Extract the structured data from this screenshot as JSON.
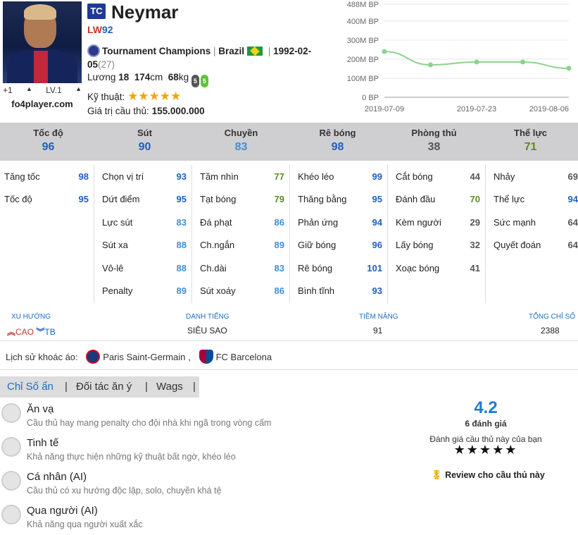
{
  "player": {
    "season_badge": "TC",
    "name": "Neymar",
    "position": "LW",
    "ovr": "92",
    "season": "Tournament Champions",
    "nation": "Brazil",
    "birth": "1992-02-",
    "birth2": "05",
    "age": "(27)",
    "salary_label": "Lương",
    "salary": "18",
    "height": "174",
    "height_unit": "cm",
    "weight": "68",
    "weight_unit": "kg",
    "left_foot": "5",
    "right_foot": "5",
    "skill_label": "Kỹ thuật:",
    "skill_stars": "★★★★★",
    "value_label": "Giá trị cầu thủ:",
    "value": "155.000.000",
    "upgrade": "+1",
    "level": "LV.1",
    "site": "fo4player.com"
  },
  "chart_data": {
    "type": "line",
    "x": [
      "2019-07-09",
      "2019-07-16",
      "2019-07-23",
      "2019-07-30",
      "2019-08-06"
    ],
    "values": [
      240,
      170,
      185,
      185,
      152
    ],
    "y_ticks": [
      "488M BP",
      "400M BP",
      "300M BP",
      "200M BP",
      "100M BP",
      "0 BP"
    ],
    "y_tick_values": [
      488,
      400,
      300,
      200,
      100,
      0
    ],
    "x_ticks": [
      "2019-07-09",
      "2019-07-23",
      "2019-08-06"
    ],
    "ylim": [
      0,
      488
    ],
    "line_color": "#8cd28e",
    "grid": true
  },
  "main_stats": [
    {
      "label": "Tốc độ",
      "value": "96",
      "color": "#1f5fc4"
    },
    {
      "label": "Sút",
      "value": "90",
      "color": "#1f5fc4"
    },
    {
      "label": "Chuyền",
      "value": "83",
      "color": "#3d8fd6"
    },
    {
      "label": "Rê bóng",
      "value": "98",
      "color": "#1f5fc4"
    },
    {
      "label": "Phòng thủ",
      "value": "38",
      "color": "#555555"
    },
    {
      "label": "Thể lực",
      "value": "71",
      "color": "#5a8a2e"
    }
  ],
  "attributes": [
    [
      {
        "label": "Tăng tốc",
        "value": "98",
        "color": "#1f5fc4"
      },
      {
        "label": "Tốc độ",
        "value": "95",
        "color": "#1f5fc4"
      }
    ],
    [
      {
        "label": "Chọn vị trí",
        "value": "93",
        "color": "#1f5fc4"
      },
      {
        "label": "Dứt điểm",
        "value": "95",
        "color": "#1f5fc4"
      },
      {
        "label": "Lực sút",
        "value": "83",
        "color": "#3d8fd6"
      },
      {
        "label": "Sút xa",
        "value": "88",
        "color": "#3d8fd6"
      },
      {
        "label": "Vô-lê",
        "value": "88",
        "color": "#3d8fd6"
      },
      {
        "label": "Penalty",
        "value": "89",
        "color": "#3d8fd6"
      }
    ],
    [
      {
        "label": "Tầm nhìn",
        "value": "77",
        "color": "#5a8a2e"
      },
      {
        "label": "Tạt bóng",
        "value": "79",
        "color": "#5a8a2e"
      },
      {
        "label": "Đá phạt",
        "value": "86",
        "color": "#3d8fd6"
      },
      {
        "label": "Ch.ngắn",
        "value": "89",
        "color": "#3d8fd6"
      },
      {
        "label": "Ch.dài",
        "value": "83",
        "color": "#3d8fd6"
      },
      {
        "label": "Sút xoáy",
        "value": "86",
        "color": "#3d8fd6"
      }
    ],
    [
      {
        "label": "Khéo léo",
        "value": "99",
        "color": "#1f5fc4"
      },
      {
        "label": "Thăng bằng",
        "value": "95",
        "color": "#1f5fc4"
      },
      {
        "label": "Phản ứng",
        "value": "94",
        "color": "#1f5fc4"
      },
      {
        "label": "Giữ bóng",
        "value": "96",
        "color": "#1f5fc4"
      },
      {
        "label": "Rê bóng",
        "value": "101",
        "color": "#1f5fc4"
      },
      {
        "label": "Bình tĩnh",
        "value": "93",
        "color": "#1f5fc4"
      }
    ],
    [
      {
        "label": "Cắt bóng",
        "value": "44",
        "color": "#555555"
      },
      {
        "label": "Đánh đầu",
        "value": "70",
        "color": "#5a8a2e"
      },
      {
        "label": "Kèm người",
        "value": "29",
        "color": "#555555"
      },
      {
        "label": "Lấy bóng",
        "value": "32",
        "color": "#555555"
      },
      {
        "label": "Xoạc bóng",
        "value": "41",
        "color": "#555555"
      }
    ],
    [
      {
        "label": "Nhảy",
        "value": "69",
        "color": "#555555"
      },
      {
        "label": "Thể lực",
        "value": "94",
        "color": "#1f5fc4"
      },
      {
        "label": "Sức mạnh",
        "value": "64",
        "color": "#555555"
      },
      {
        "label": "Quyết đoán",
        "value": "64",
        "color": "#555555"
      }
    ]
  ],
  "summary": {
    "trend_label": "XU HƯỚNG",
    "trend_attack": "CAO",
    "trend_defense": "TB",
    "fame_label": "DANH TIẾNG",
    "fame_value": "SIÊU SAO",
    "potential_label": "TIỀM NĂNG",
    "potential_value": "91",
    "total_label": "TỔNG CHỈ SỐ",
    "total_value": "2388"
  },
  "jersey_history": {
    "label": "Lịch sử khoác áo:",
    "clubs": [
      "Paris Saint-Germain",
      "FC Barcelona"
    ],
    "sep": ","
  },
  "tabs": [
    "Chỉ Số ẩn",
    "Đối tác ăn ý",
    "Wags"
  ],
  "traits": [
    {
      "name": "Ăn vạ",
      "desc": "Cầu thủ hay mang penalty cho đội nhà khi ngã trong vòng cấm"
    },
    {
      "name": "Tinh tế",
      "desc": "Khả năng thực hiện những kỹ thuật bất ngờ, khéo léo"
    },
    {
      "name": "Cá nhân (AI)",
      "desc": "Cầu thủ có xu hướng độc lập, solo, chuyền khá tệ"
    },
    {
      "name": "Qua người (AI)",
      "desc": "Khả năng qua người xuất xắc"
    }
  ],
  "rating": {
    "score": "4.2",
    "count": "6 đánh giá",
    "prompt": "Đánh giá cầu thủ này của bạn",
    "stars": "★★★★★",
    "review_button": "Review cho cầu thủ này"
  }
}
